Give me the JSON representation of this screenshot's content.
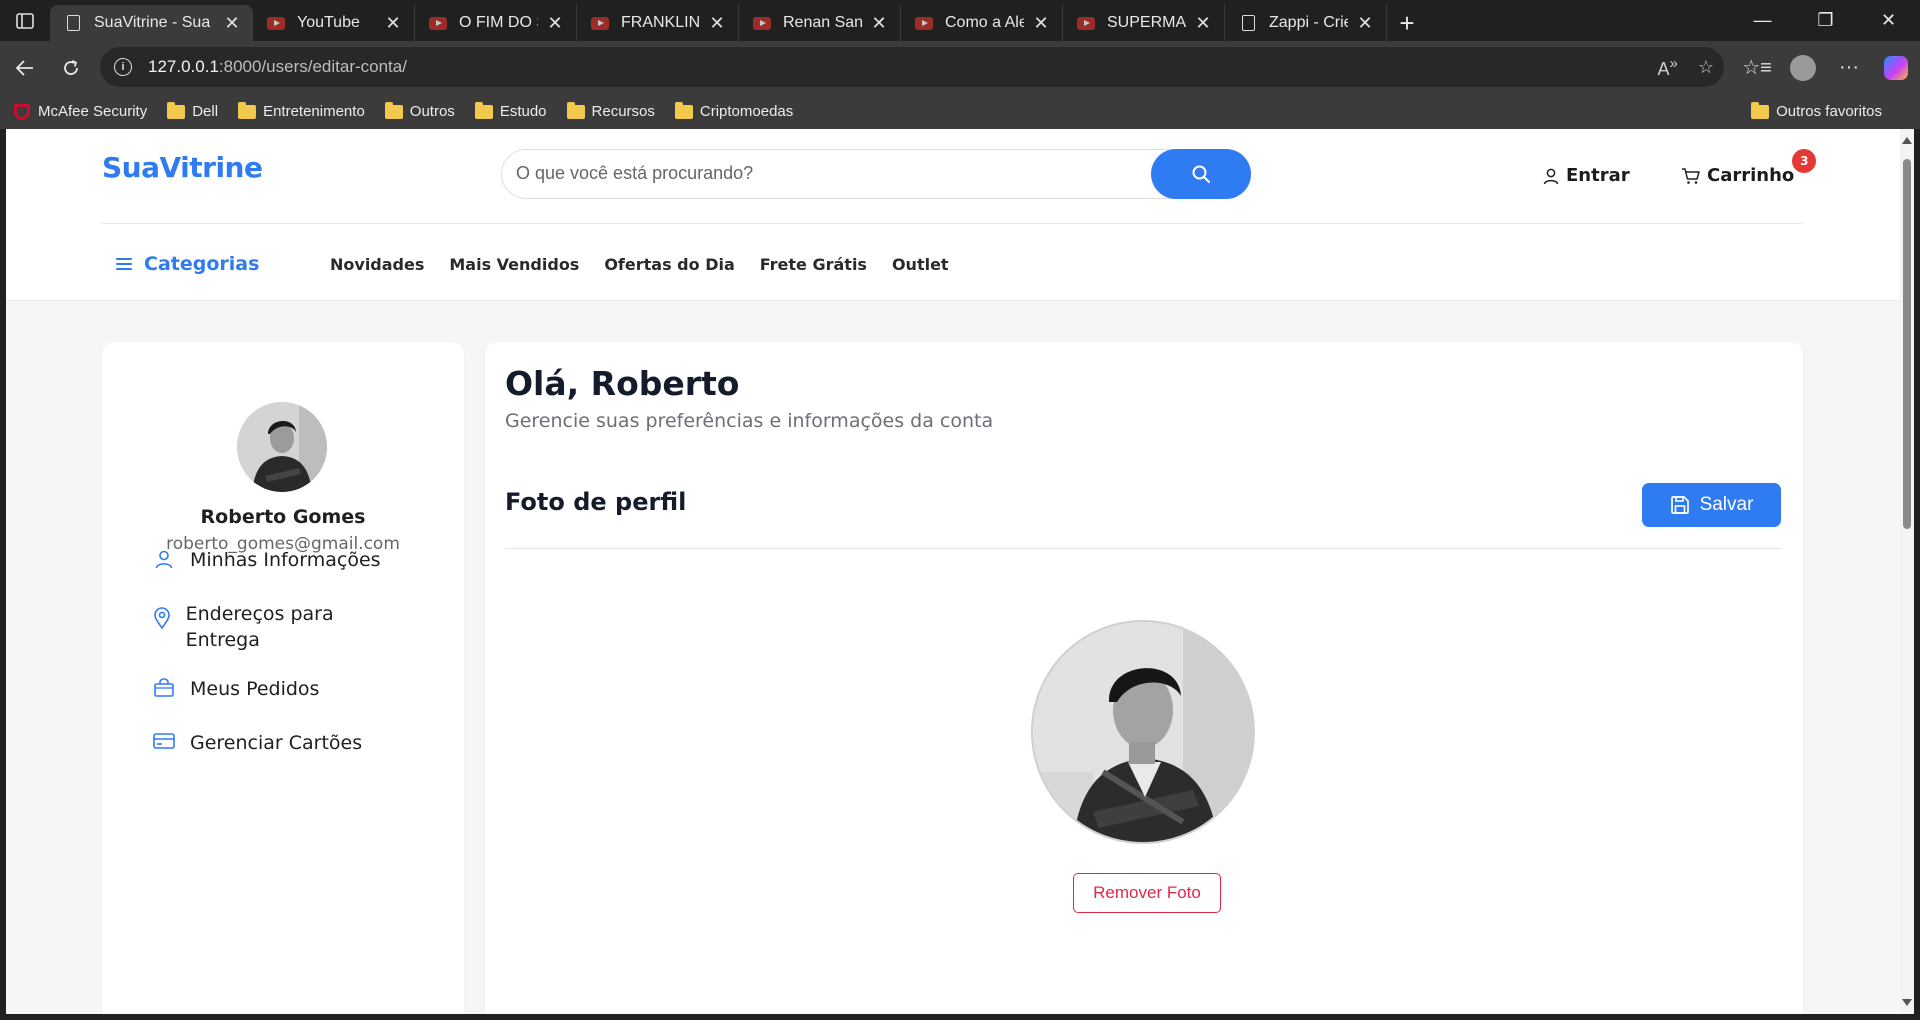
{
  "browser": {
    "tabs": [
      {
        "title": "SuaVitrine - Sua lo",
        "icon": "page-icon",
        "active": true
      },
      {
        "title": "YouTube",
        "icon": "youtube-icon",
        "active": false
      },
      {
        "title": "O FIM DO STF E D",
        "icon": "youtube-icon",
        "active": false
      },
      {
        "title": "FRANKLIN RICHAR",
        "icon": "youtube-icon",
        "active": false
      },
      {
        "title": "Renan Santos REA",
        "icon": "youtube-icon",
        "active": false
      },
      {
        "title": "Como a Alemanha",
        "icon": "youtube-icon",
        "active": false
      },
      {
        "title": "SUPERMAN. JÁ PE",
        "icon": "youtube-icon",
        "active": false
      },
      {
        "title": "Zappi - Crie sua lo",
        "icon": "page-icon",
        "active": false
      }
    ],
    "close_glyph": "✕",
    "new_tab_glyph": "+",
    "url_host": "127.0.0.1",
    "url_rest": ":8000/users/editar-conta/",
    "bookmarks": [
      "McAfee Security",
      "Dell",
      "Entretenimento",
      "Outros",
      "Estudo",
      "Recursos",
      "Criptomoedas"
    ],
    "bookmarks_right": "Outros favoritos",
    "accent_color": "#2f7bf1"
  },
  "header": {
    "logo": "SuaVitrine",
    "search_placeholder": "O que você está procurando?",
    "login_label": "Entrar",
    "cart_label": "Carrinho",
    "cart_count": "3",
    "categories_label": "Categorias",
    "nav": [
      "Novidades",
      "Mais Vendidos",
      "Ofertas do Dia",
      "Frete Grátis",
      "Outlet"
    ]
  },
  "sidebar": {
    "user_name": "Roberto Gomes",
    "user_email": "roberto_gomes@gmail.com",
    "menu": [
      {
        "label": "Minhas Informações",
        "icon": "user-icon"
      },
      {
        "label": "Endereços para Entrega",
        "icon": "map-pin-icon"
      },
      {
        "label": "Meus Pedidos",
        "icon": "shopping-bag-icon"
      },
      {
        "label": "Gerenciar Cartões",
        "icon": "credit-card-icon"
      }
    ]
  },
  "main": {
    "greeting": "Olá, Roberto",
    "subtitle": "Gerencie suas preferências e informações da conta",
    "section_title": "Foto de perfil",
    "save_label": "Salvar",
    "remove_photo_label": "Remover Foto"
  }
}
